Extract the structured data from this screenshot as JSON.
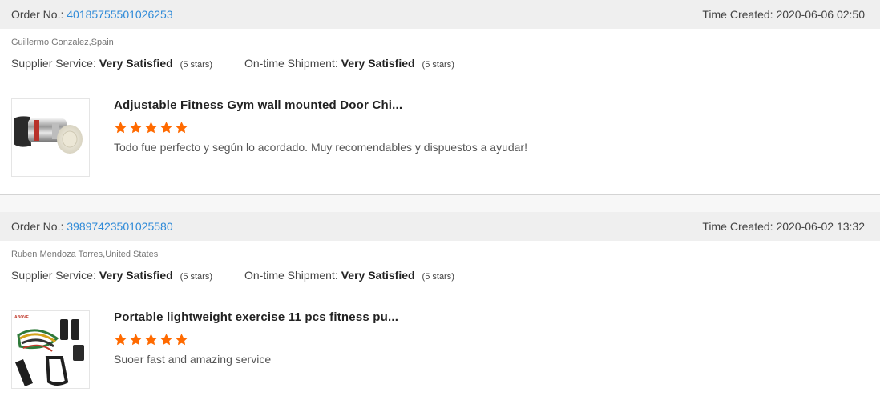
{
  "colors": {
    "accent_link": "#2e8ad8",
    "star": "#ff6a00",
    "header_bg": "#efefef"
  },
  "orders": [
    {
      "order_no_label": "Order No.:",
      "order_no": "40185755501026253",
      "time_label": "Time Created:",
      "time": "2020-06-06 02:50",
      "buyer": "Guillermo Gonzalez,Spain",
      "supplier_label": "Supplier Service:",
      "supplier_value": "Very Satisfied",
      "supplier_stars": "(5 stars)",
      "shipment_label": "On-time Shipment:",
      "shipment_value": "Very Satisfied",
      "shipment_stars": "(5 stars)",
      "product_image_icon": "pull-up-bar-product-image",
      "product_title": "Adjustable Fitness Gym wall mounted Door Chi...",
      "rating": 5,
      "comment": "Todo fue perfecto y según lo acordado. Muy recomendables y dispuestos a ayudar!"
    },
    {
      "order_no_label": "Order No.:",
      "order_no": "39897423501025580",
      "time_label": "Time Created:",
      "time": "2020-06-02 13:32",
      "buyer": "Ruben Mendoza Torres,United States",
      "supplier_label": "Supplier Service:",
      "supplier_value": "Very Satisfied",
      "supplier_stars": "(5 stars)",
      "shipment_label": "On-time Shipment:",
      "shipment_value": "Very Satisfied",
      "shipment_stars": "(5 stars)",
      "product_image_icon": "resistance-bands-product-image",
      "product_title": "Portable lightweight exercise 11 pcs fitness pu...",
      "rating": 5,
      "comment": "Suoer fast and amazing service"
    }
  ]
}
